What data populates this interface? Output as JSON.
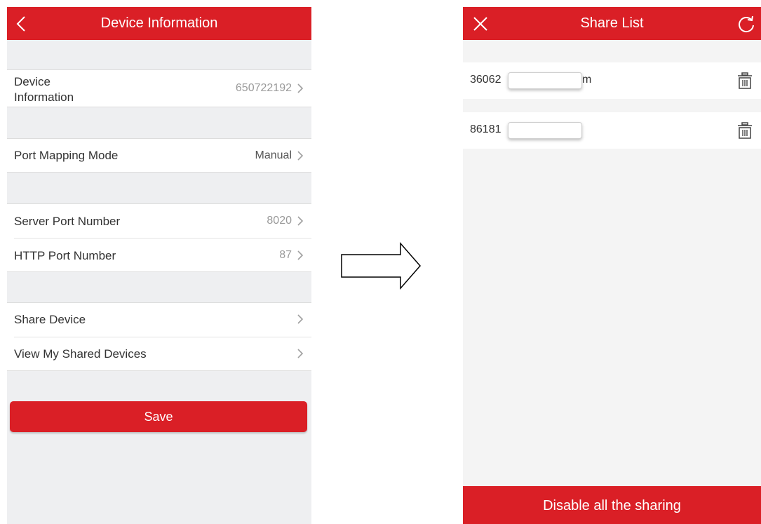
{
  "device_info": {
    "title": "Device Information",
    "rows": [
      {
        "label": "Device Information",
        "value": "650722192"
      },
      {
        "label": "Port Mapping Mode",
        "value": "Manual"
      },
      {
        "label": "Server Port Number",
        "value": "8020"
      },
      {
        "label": "HTTP Port Number",
        "value": "87"
      },
      {
        "label": "Share Device",
        "value": ""
      },
      {
        "label": "View My Shared Devices",
        "value": ""
      }
    ],
    "save_label": "Save"
  },
  "share_list": {
    "title": "Share List",
    "items": [
      {
        "prefix": "36062",
        "suffix": "m"
      },
      {
        "prefix": "86181",
        "suffix": ""
      }
    ],
    "disable_label": "Disable all the sharing"
  },
  "colors": {
    "accent": "#da1f26",
    "background": "#eeeff1"
  },
  "icons": [
    "back-icon",
    "close-icon",
    "refresh-icon",
    "trash-icon",
    "chevron-right-icon",
    "arrow-right-icon"
  ]
}
